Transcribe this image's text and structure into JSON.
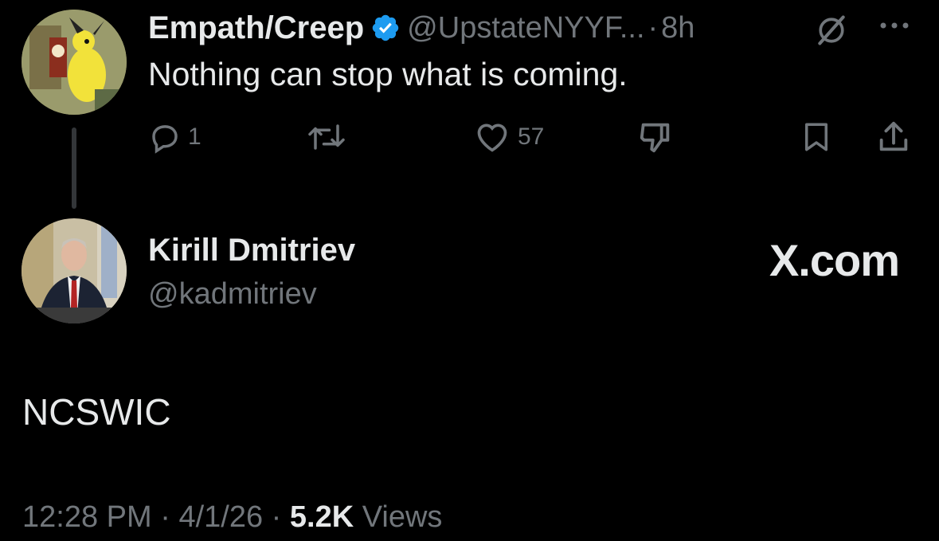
{
  "reply_tweet": {
    "author_name": "Empath/Creep",
    "verified_icon": "verified-badge-icon",
    "handle": "@UpstateNYYF...",
    "separator": "·",
    "time": "8h",
    "text": "Nothing can stop what is coming.",
    "actions": {
      "reply_count": "1",
      "like_count": "57"
    },
    "icons": [
      "grok-icon",
      "more-icon",
      "reply-icon",
      "retweet-icon",
      "like-icon",
      "dislike-icon",
      "bookmark-icon",
      "share-icon"
    ]
  },
  "main_tweet": {
    "author_name": "Kirill Dmitriev",
    "handle": "@kadmitriev",
    "site_label": "X.com",
    "text": "NCSWIC",
    "timestamp": "12:28 PM",
    "sep1": "·",
    "date": "4/1/26",
    "sep2": "·",
    "views_count": "5.2K",
    "views_label": "Views"
  },
  "colors": {
    "background": "#000000",
    "text": "#e7e9ea",
    "muted": "#71767b",
    "verified": "#1d9bf0"
  }
}
